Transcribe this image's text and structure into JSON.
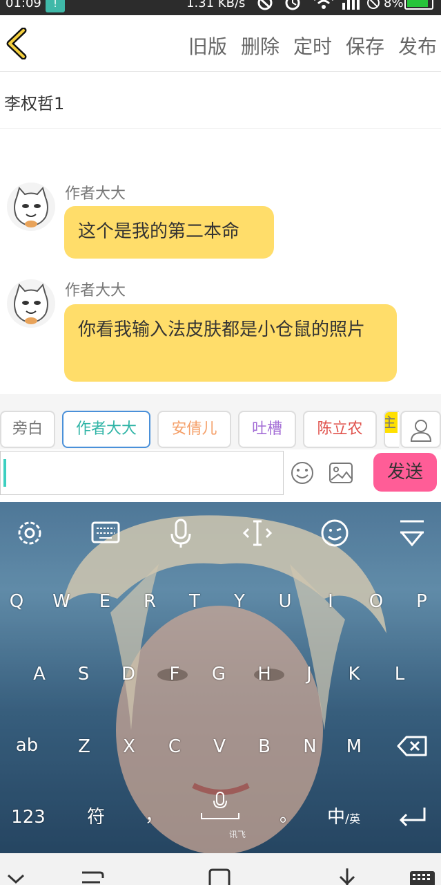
{
  "status": {
    "time": "01:09",
    "sim": "!",
    "speed": "1.31 KB/s",
    "battery": "8%",
    "accent": "#27c43a"
  },
  "nav": {
    "back_icon": "chevron-left-icon",
    "actions": [
      "旧版",
      "删除",
      "定时",
      "保存",
      "发布"
    ]
  },
  "story_title": "李权哲1",
  "messages": [
    {
      "speaker": "作者大大",
      "text": "这个是我的第二本命"
    },
    {
      "speaker": "作者大大",
      "text": "你看我输入法皮肤都是小仓鼠的照片"
    }
  ],
  "roles": [
    {
      "label": "旁白",
      "color": "#777777"
    },
    {
      "label": "作者大大",
      "color": "#2fb4a6"
    },
    {
      "label": "安倩儿",
      "color": "#f5a06a"
    },
    {
      "label": "吐槽",
      "color": "#a46ed6"
    },
    {
      "label": "陈立农",
      "color": "#e0524c"
    }
  ],
  "role_partial": "主",
  "input": {
    "value": "",
    "send_label": "发送",
    "send_color": "#ff5d97"
  },
  "keyboard": {
    "top_icons": [
      "settings-gear-icon",
      "keyboard-icon",
      "microphone-icon",
      "cursor-move-icon",
      "emoji-icon",
      "hide-keyboard-icon"
    ],
    "row1": [
      "Q",
      "W",
      "E",
      "R",
      "T",
      "Y",
      "U",
      "I",
      "O",
      "P"
    ],
    "row2": [
      "A",
      "S",
      "D",
      "F",
      "G",
      "H",
      "J",
      "K",
      "L"
    ],
    "row3_left": "ab",
    "row3": [
      "Z",
      "X",
      "C",
      "V",
      "B",
      "N",
      "M"
    ],
    "row4": {
      "numbers": "123",
      "symbols": "符",
      "comma": "，",
      "period": "。",
      "lang_main": "中",
      "lang_sep": "/",
      "lang_alt": "英"
    },
    "brand": "讯飞"
  }
}
